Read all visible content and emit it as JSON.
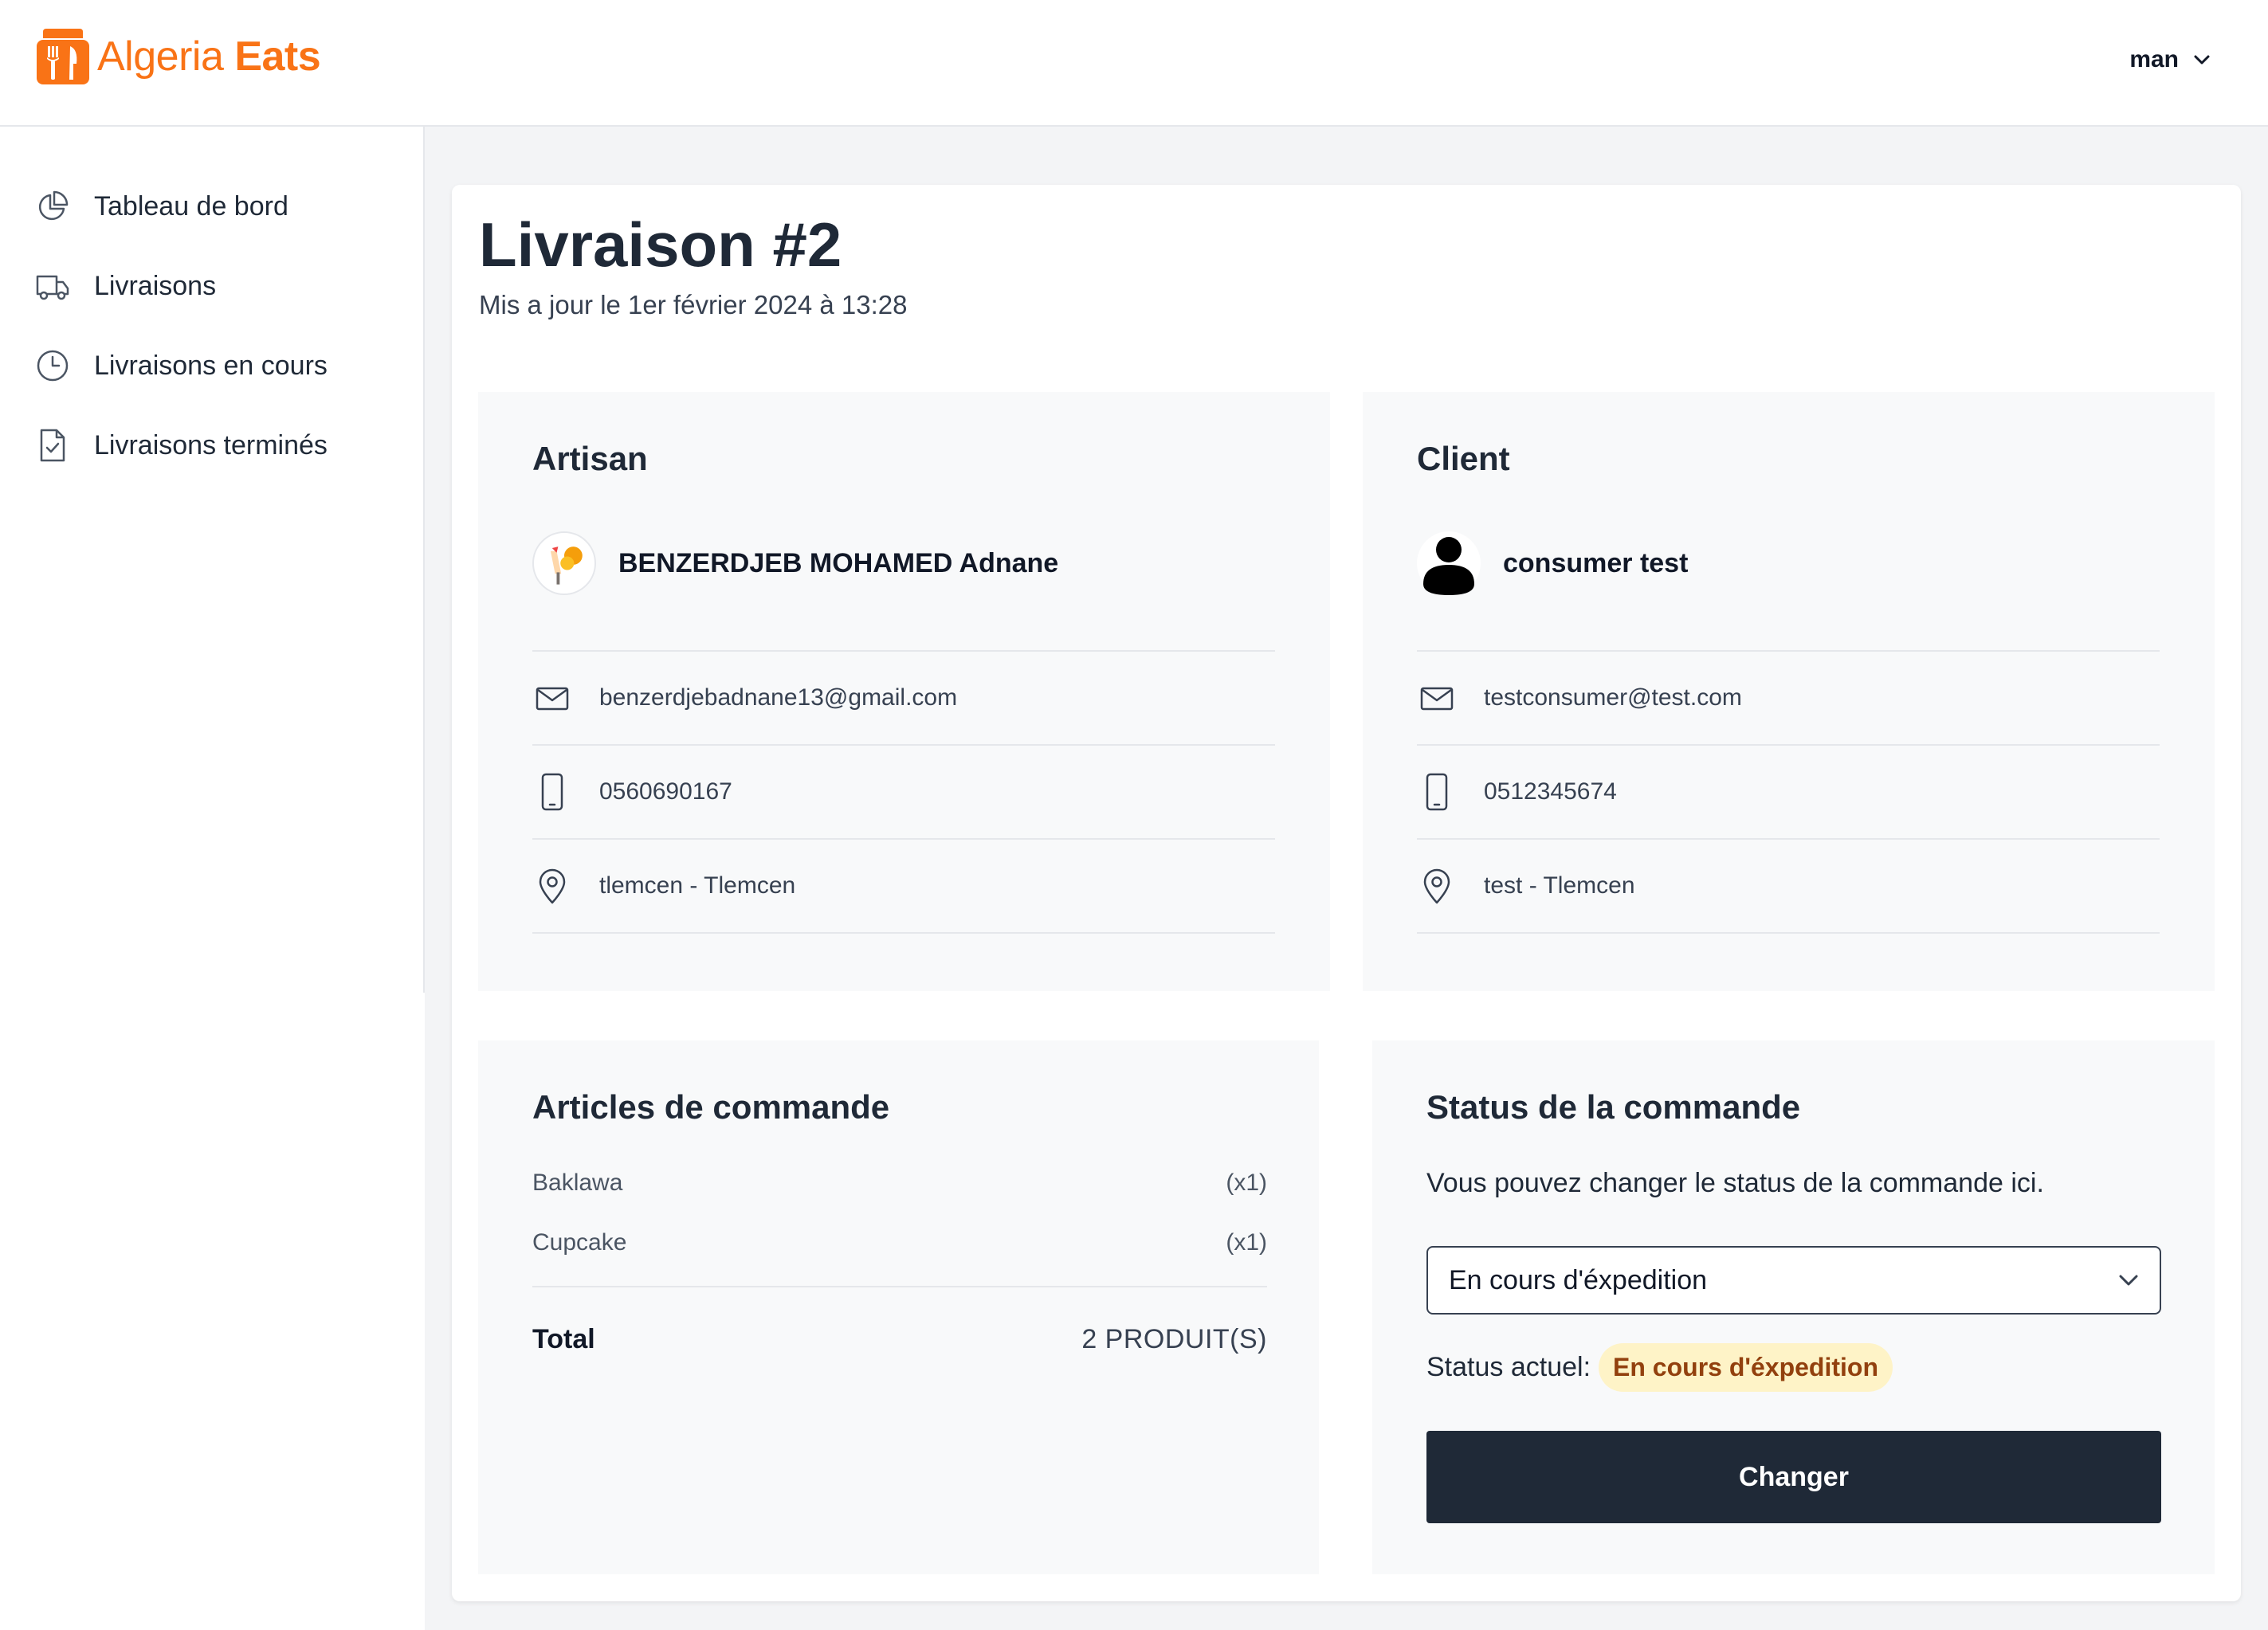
{
  "brand": {
    "name_light": "Algeria",
    "name_bold": "Eats",
    "accent": "#f97316"
  },
  "header": {
    "user_name": "man"
  },
  "sidebar": {
    "items": [
      {
        "label": "Tableau de bord",
        "icon": "chart-pie-icon"
      },
      {
        "label": "Livraisons",
        "icon": "truck-icon"
      },
      {
        "label": "Livraisons en cours",
        "icon": "clock-icon"
      },
      {
        "label": "Livraisons terminés",
        "icon": "document-check-icon"
      }
    ]
  },
  "page": {
    "title": "Livraison #2",
    "subtitle": "Mis a jour le 1er février 2024 à 13:28"
  },
  "artisan": {
    "section_title": "Artisan",
    "name": "BENZERDJEB MOHAMED Adnane",
    "email": "benzerdjebadnane13@gmail.com",
    "phone": "0560690167",
    "address": "tlemcen - Tlemcen"
  },
  "client": {
    "section_title": "Client",
    "name": "consumer test",
    "email": "testconsumer@test.com",
    "phone": "0512345674",
    "address": "test - Tlemcen"
  },
  "articles": {
    "section_title": "Articles de commande",
    "items": [
      {
        "name": "Baklawa",
        "qty": "(x1)"
      },
      {
        "name": "Cupcake",
        "qty": "(x1)"
      }
    ],
    "total_label": "Total",
    "total_value": "2 PRODUIT(S)"
  },
  "status": {
    "section_title": "Status de la commande",
    "description": "Vous pouvez changer le status de la commande ici.",
    "selected": "En cours d'éxpedition",
    "current_label": "Status actuel:",
    "current_value": "En cours d'éxpedition",
    "badge_bg": "#fef3c7",
    "badge_color": "#92400e",
    "button_label": "Changer"
  }
}
